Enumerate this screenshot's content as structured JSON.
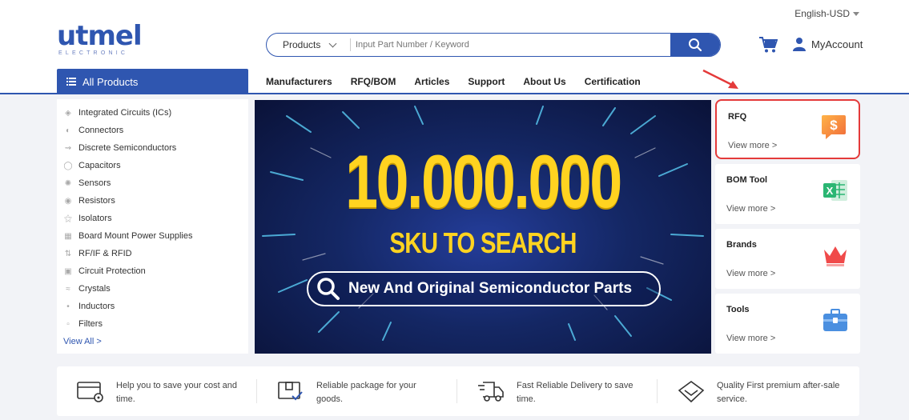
{
  "header": {
    "language": "English-USD",
    "logo_text": "utmel",
    "logo_subtext": "ELECTRONIC",
    "account_label": "MyAccount"
  },
  "search": {
    "category": "Products",
    "placeholder": "Input Part Number / Keyword"
  },
  "all_products_label": "All Products",
  "nav": [
    "Manufacturers",
    "RFQ/BOM",
    "Articles",
    "Support",
    "About Us",
    "Certification"
  ],
  "categories": [
    {
      "label": "Integrated Circuits (ICs)",
      "icon": "chip-icon"
    },
    {
      "label": "Connectors",
      "icon": "connector-icon"
    },
    {
      "label": "Discrete Semiconductors",
      "icon": "diode-icon"
    },
    {
      "label": "Capacitors",
      "icon": "capacitor-icon"
    },
    {
      "label": "Sensors",
      "icon": "sensor-icon"
    },
    {
      "label": "Resistors",
      "icon": "resistor-icon"
    },
    {
      "label": "Isolators",
      "icon": "isolator-icon"
    },
    {
      "label": "Board Mount Power Supplies",
      "icon": "power-supply-icon"
    },
    {
      "label": "RF/IF & RFID",
      "icon": "rf-icon"
    },
    {
      "label": "Circuit Protection",
      "icon": "protection-icon"
    },
    {
      "label": "Crystals",
      "icon": "crystal-icon"
    },
    {
      "label": "Inductors",
      "icon": "inductor-icon"
    },
    {
      "label": "Filters",
      "icon": "filter-icon"
    }
  ],
  "view_all_label": "View All >",
  "banner": {
    "headline": "10.000.000",
    "subheadline": "SKU TO SEARCH",
    "tagline": "New And Original Semiconductor Parts"
  },
  "side_cards": [
    {
      "title": "RFQ",
      "more": "View more >",
      "icon": "dollar-icon"
    },
    {
      "title": "BOM Tool",
      "more": "View more >",
      "icon": "excel-icon"
    },
    {
      "title": "Brands",
      "more": "View more >",
      "icon": "crown-icon"
    },
    {
      "title": "Tools",
      "more": "View more >",
      "icon": "toolbox-icon"
    }
  ],
  "features": [
    {
      "text": "Help you to save your cost and time.",
      "icon": "card-icon"
    },
    {
      "text": "Reliable package for your goods.",
      "icon": "package-icon"
    },
    {
      "text": "Fast Reliable Delivery to save time.",
      "icon": "truck-icon"
    },
    {
      "text": "Quality First premium after-sale service.",
      "icon": "diamond-icon"
    }
  ],
  "colors": {
    "brand_blue": "#2f56b0",
    "banner_yellow": "#ffd320",
    "highlight_red": "#e43a3a"
  }
}
